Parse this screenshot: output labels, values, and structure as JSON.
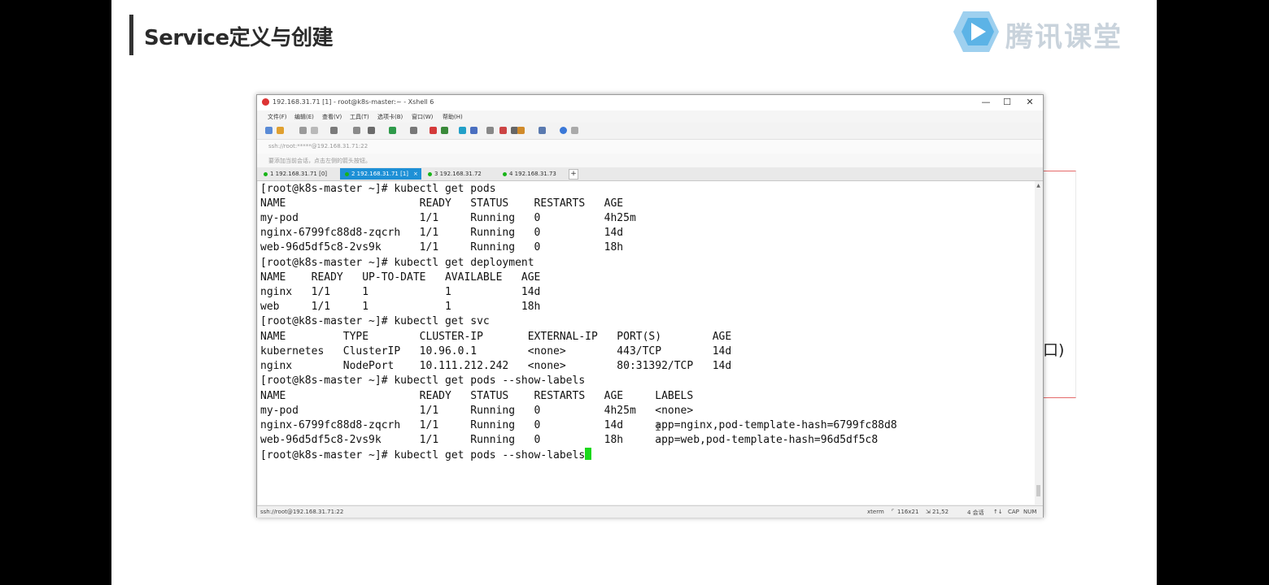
{
  "slide": {
    "title": "Service定义与创建",
    "logo_text": "腾讯课堂",
    "bg_fragment": "口)"
  },
  "window": {
    "title": "192.168.31.71 [1] - root@k8s-master:~ - Xshell 6",
    "minimize": "—",
    "maximize": "☐",
    "close": "✕",
    "menu": [
      "文件(F)",
      "编辑(E)",
      "查看(V)",
      "工具(T)",
      "选项卡(B)",
      "窗口(W)",
      "帮助(H)"
    ],
    "address": "ssh://root:*****@192.168.31.71:22",
    "notice": "要添加当前会话，点击左侧的箭头按钮。",
    "tabs": [
      {
        "label": "1 192.168.31.71 [0]",
        "active": false
      },
      {
        "label": "2 192.168.31.71 [1]",
        "active": true,
        "close": "×"
      },
      {
        "label": "3 192.168.31.72",
        "active": false
      },
      {
        "label": "4 192.168.31.73",
        "active": false
      }
    ],
    "tab_add": "+",
    "status": {
      "left": "ssh://root@192.168.31.71:22",
      "term": "xterm",
      "size": "116x21",
      "pos": "21,52",
      "sessions": "4 会话",
      "caps": "CAP",
      "num": "NUM"
    }
  },
  "terminal": {
    "lines": [
      "[root@k8s-master ~]# kubectl get pods",
      "NAME                     READY   STATUS    RESTARTS   AGE",
      "my-pod                   1/1     Running   0          4h25m",
      "nginx-6799fc88d8-zqcrh   1/1     Running   0          14d",
      "web-96d5df5c8-2vs9k      1/1     Running   0          18h",
      "[root@k8s-master ~]# kubectl get deployment",
      "NAME    READY   UP-TO-DATE   AVAILABLE   AGE",
      "nginx   1/1     1            1           14d",
      "web     1/1     1            1           18h",
      "[root@k8s-master ~]# kubectl get svc",
      "NAME         TYPE        CLUSTER-IP       EXTERNAL-IP   PORT(S)        AGE",
      "kubernetes   ClusterIP   10.96.0.1        <none>        443/TCP        14d",
      "nginx        NodePort    10.111.212.242   <none>        80:31392/TCP   14d",
      "[root@k8s-master ~]# kubectl get pods --show-labels",
      "NAME                     READY   STATUS    RESTARTS   AGE     LABELS",
      "my-pod                   1/1     Running   0          4h25m   <none>",
      "nginx-6799fc88d8-zqcrh   1/1     Running   0          14d     app=nginx,pod-template-hash=6799fc88d8",
      "web-96d5df5c8-2vs9k      1/1     Running   0          18h     app=web,pod-template-hash=96d5df5c8"
    ],
    "prompt": "[root@k8s-master ~]# ",
    "current_input": "kubectl get pods --show-labels"
  },
  "colors": {
    "tab_active": "#1e90d6",
    "cursor": "#1bd81b",
    "slide_accent": "#e46a6a"
  }
}
